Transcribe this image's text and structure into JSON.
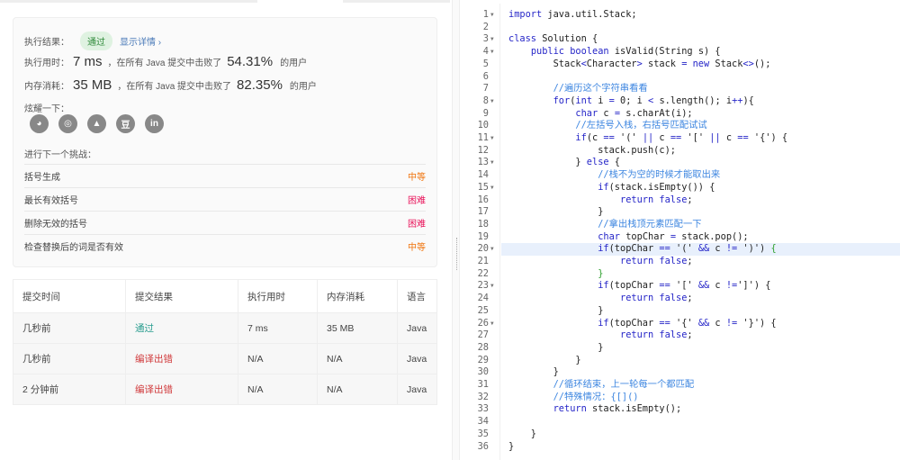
{
  "result": {
    "label": "执行结果：",
    "status": "通过",
    "details": "显示详情 ›"
  },
  "runtime": {
    "label": "执行用时：",
    "value": "7 ms",
    "mid": "，在所有 Java 提交中击败了",
    "pct": "54.31%",
    "tail": "的用户"
  },
  "memory": {
    "label": "内存消耗：",
    "value": "35 MB",
    "mid": "，在所有 Java 提交中击败了",
    "pct": "82.35%",
    "tail": "的用户"
  },
  "share": {
    "label": "炫耀一下：",
    "icons": [
      "wechat-icon",
      "weibo-icon",
      "qq-icon",
      "douban-icon",
      "linkedin-icon"
    ],
    "glyphs": [
      "◕",
      "◎",
      "▲",
      "豆",
      "in"
    ]
  },
  "next": {
    "label": "进行下一个挑战：",
    "items": [
      {
        "title": "括号生成",
        "level": "中等"
      },
      {
        "title": "最长有效括号",
        "level": "困难"
      },
      {
        "title": "删除无效的括号",
        "level": "困难"
      },
      {
        "title": "检查替换后的词是否有效",
        "level": "中等"
      }
    ]
  },
  "table": {
    "headers": [
      "提交时间",
      "提交结果",
      "执行用时",
      "内存消耗",
      "语言"
    ],
    "rows": [
      [
        "几秒前",
        "通过",
        "7 ms",
        "35 MB",
        "Java"
      ],
      [
        "几秒前",
        "编译出错",
        "N/A",
        "N/A",
        "Java"
      ],
      [
        "2 分钟前",
        "编译出错",
        "N/A",
        "N/A",
        "Java"
      ]
    ]
  },
  "colors": {
    "pass": "#2a9d8f",
    "error": "#d0383a",
    "medium": "#f0750f",
    "hard": "#e9145b"
  },
  "editor": {
    "highlighted_line": 20,
    "fold_lines": [
      1,
      3,
      4,
      8,
      11,
      13,
      15,
      20,
      23,
      26
    ],
    "lines": [
      "import java.util.Stack;",
      "",
      "class Solution {",
      "    public boolean isValid(String s) {",
      "        Stack<Character> stack = new Stack<>();",
      "",
      "        //遍历这个字符串看看",
      "        for(int i = 0; i < s.length(); i++){",
      "            char c = s.charAt(i);",
      "            //左括号入栈，右括号匹配试试",
      "            if(c == '(' || c == '[' || c == '{') {",
      "                stack.push(c);",
      "            } else {",
      "                //栈不为空的时候才能取出来",
      "                if(stack.isEmpty()) {",
      "                    return false;",
      "                }",
      "                //拿出栈顶元素匹配一下",
      "                char topChar = stack.pop();",
      "                if(topChar == '(' && c != ')') {",
      "                    return false;",
      "                }",
      "                if(topChar == '[' && c !=']') {",
      "                    return false;",
      "                }",
      "                if(topChar == '{' && c != '}') {",
      "                    return false;",
      "                }",
      "            }",
      "        }",
      "        //循环结束，上一轮每一个都匹配",
      "        //特殊情况：{[]()",
      "        return stack.isEmpty();",
      "",
      "    }",
      "}"
    ]
  }
}
